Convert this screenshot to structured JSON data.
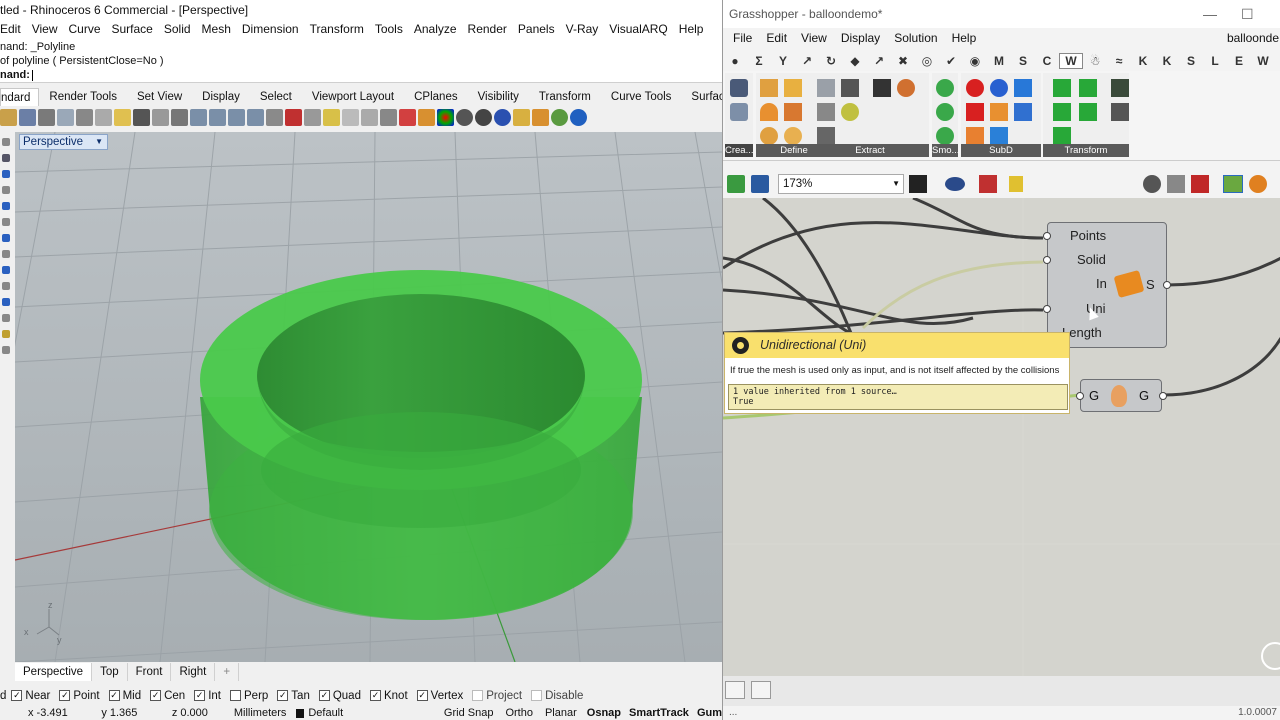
{
  "rhino": {
    "title": "tled - Rhinoceros 6 Commercial - [Perspective]",
    "menu": [
      "Edit",
      "View",
      "Curve",
      "Surface",
      "Solid",
      "Mesh",
      "Dimension",
      "Transform",
      "Tools",
      "Analyze",
      "Render",
      "Panels",
      "V-Ray",
      "VisualARQ",
      "Help"
    ],
    "command_history": [
      "nand: _Polyline",
      "of polyline ( PersistentClose=No )"
    ],
    "command_prompt": "nand:",
    "toolbar_tabs": [
      "ndard",
      "Render Tools",
      "Set View",
      "Display",
      "Select",
      "Viewport Layout",
      "CPlanes",
      "Visibility",
      "Transform",
      "Curve Tools",
      "Surface Tools"
    ],
    "viewport_label": "Perspective",
    "viewport_tabs": [
      "Perspective",
      "Top",
      "Front",
      "Right"
    ],
    "osnaps": [
      {
        "label": "Near",
        "checked": true
      },
      {
        "label": "Point",
        "checked": true
      },
      {
        "label": "Mid",
        "checked": true
      },
      {
        "label": "Cen",
        "checked": true
      },
      {
        "label": "Int",
        "checked": true
      },
      {
        "label": "Perp",
        "checked": false
      },
      {
        "label": "Tan",
        "checked": true
      },
      {
        "label": "Quad",
        "checked": true
      },
      {
        "label": "Knot",
        "checked": true
      },
      {
        "label": "Vertex",
        "checked": true
      },
      {
        "label": "Project",
        "checked": false
      },
      {
        "label": "Disable",
        "checked": false
      }
    ],
    "status": {
      "x": "x -3.491",
      "y": "y 1.365",
      "z": "z 0.000",
      "units": "Millimeters",
      "layer": "Default",
      "toggles": [
        "Grid Snap",
        "Ortho",
        "Planar",
        "Osnap",
        "SmartTrack",
        "Gum"
      ]
    },
    "axis_labels": {
      "z": "z",
      "y": "y",
      "x": "x"
    },
    "colors": {
      "object_green": "#2fb52f",
      "viewport_bg": "#a4acb1"
    }
  },
  "grasshopper": {
    "title": "Grasshopper - balloondemo*",
    "menu": [
      "File",
      "Edit",
      "View",
      "Display",
      "Solution",
      "Help"
    ],
    "menu_right": "balloonde",
    "tabs": [
      "●",
      "Σ",
      "Y",
      "↗",
      "↻",
      "◆",
      "↗",
      "✖",
      "◎",
      "✔",
      "◉",
      "M",
      "S",
      "C",
      "W",
      "☃",
      "≈",
      "K",
      "K",
      "S",
      "L",
      "E",
      "W"
    ],
    "active_tab_index": 14,
    "ribbon_groups": [
      "Crea...",
      "Define",
      "Extract",
      "Smo...",
      "SubD",
      "Transform"
    ],
    "zoom": "173%",
    "component": {
      "inputs": [
        "Points",
        "Solid",
        "In",
        "Uni",
        "Length"
      ],
      "output": "S"
    },
    "component2": {
      "left": "G",
      "right": "G"
    },
    "tooltip": {
      "title": "Unidirectional (Uni)",
      "description": "If true the mesh is used only as input, and is not itself affected by the collisions",
      "value_line1": "1 value inherited from 1 source…",
      "value_line2": "True"
    },
    "version": "1.0.0007",
    "status_left": "..."
  }
}
